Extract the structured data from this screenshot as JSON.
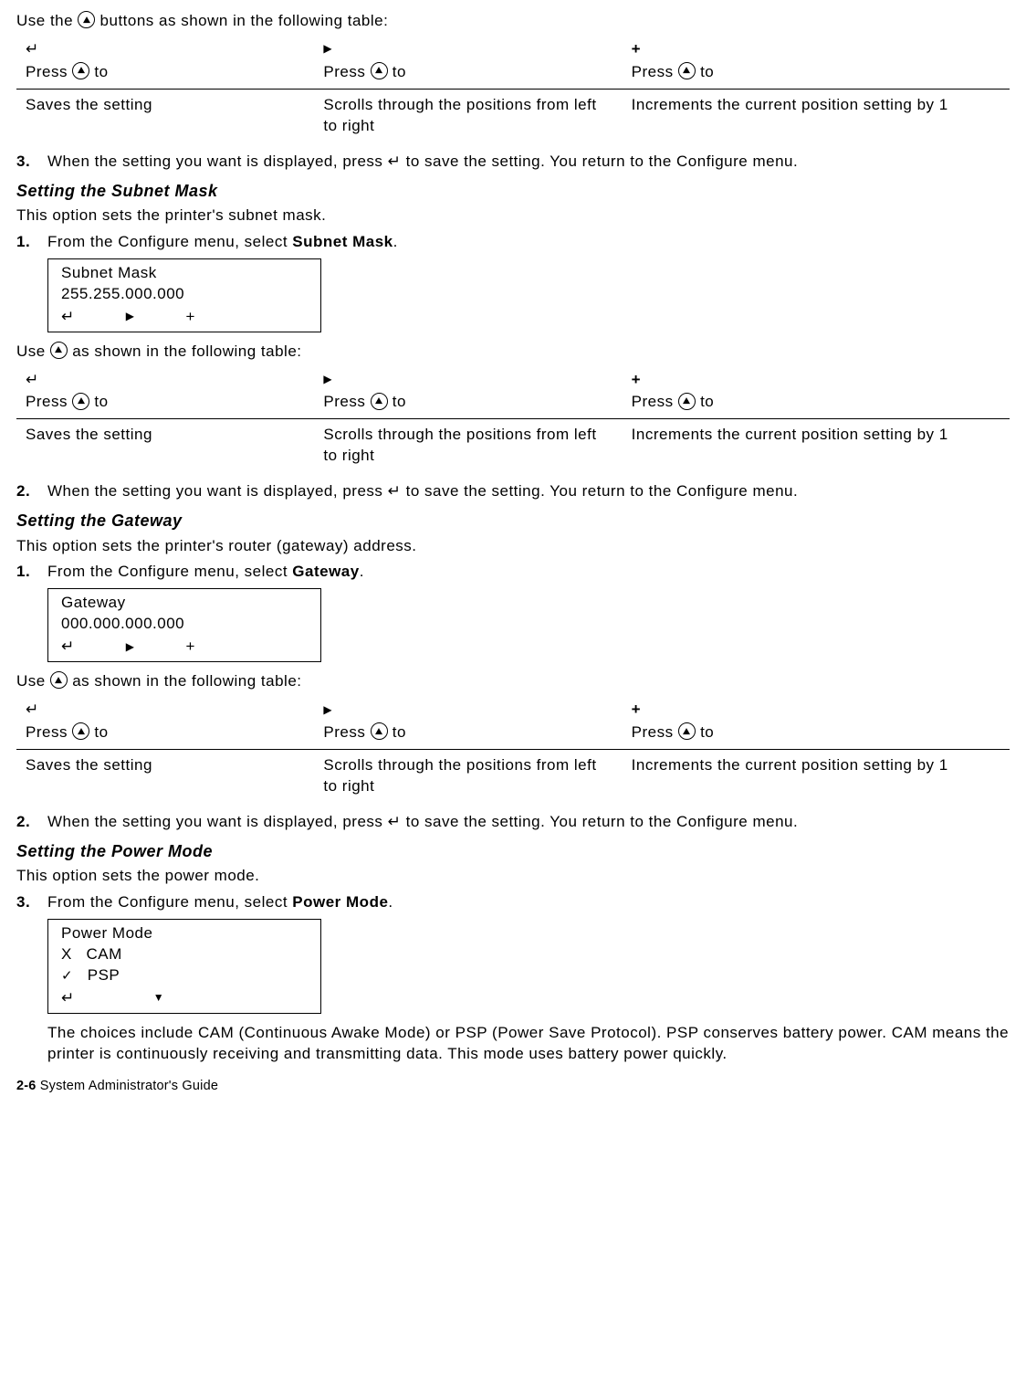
{
  "intro_line_prefix": "Use the ",
  "intro_line_suffix": " buttons as shown in the following table:",
  "enter_symbol": "↵",
  "plus_symbol": "+",
  "press_prefix": "Press ",
  "press_suffix": " to",
  "table": {
    "col1_desc": "Saves the setting",
    "col2_desc": "Scrolls through the positions from left to right",
    "col3_desc": "Increments the current position setting by 1"
  },
  "step3_num": "3.",
  "step3_text_a": "When the setting you want is displayed, press ",
  "step3_text_b": " to save the setting.  You return to the Configure menu.",
  "subnet": {
    "title": "Setting the Subnet Mask",
    "intro": "This option sets the printer's subnet mask.",
    "step1_num": "1.",
    "step1_text": "From the Configure menu, select ",
    "step1_bold": "Subnet Mask",
    "step1_period": ".",
    "display_title": "Subnet Mask",
    "display_value": "255.255.000.000"
  },
  "use_line_prefix": "Use ",
  "use_line_suffix": " as shown in the following table:",
  "step2_num": "2.",
  "step2_text_a": "When the setting you want is displayed, press ",
  "step2_text_b": " to save the setting.  You return to the Configure menu.",
  "gateway": {
    "title": "Setting the Gateway",
    "intro": "This option sets the printer's router (gateway) address.",
    "step1_num": "1.",
    "step1_text": "From the Configure menu, select ",
    "step1_bold": "Gateway",
    "step1_period": ".",
    "display_title": "Gateway",
    "display_value": "000.000.000.000"
  },
  "power": {
    "title": "Setting the Power Mode",
    "intro": "This option sets the power mode.",
    "step_num": "3.",
    "step_text": "From the Configure menu, select ",
    "step_bold": "Power Mode",
    "step_period": ".",
    "display_title": "Power Mode",
    "opt1_mark": "X",
    "opt1_label": "CAM",
    "opt2_label": "PSP",
    "explain": "The choices include CAM (Continuous Awake Mode) or PSP (Power Save Protocol).  PSP conserves battery power.  CAM means the printer is continuously receiving and transmitting data.  This mode uses battery power quickly."
  },
  "footer_page": "2-6",
  "footer_title": "  System Administrator's Guide"
}
